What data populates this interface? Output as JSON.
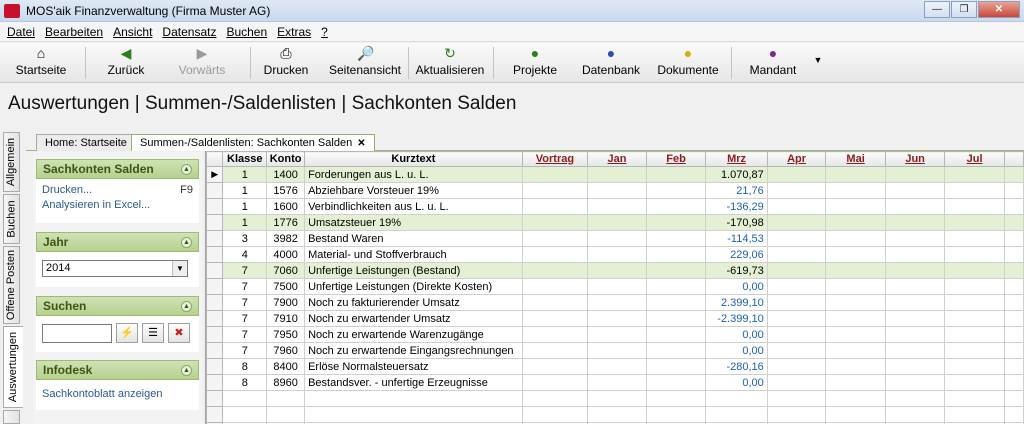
{
  "window": {
    "title": "MOS'aik Finanzverwaltung (Firma Muster AG)"
  },
  "menu": [
    "Datei",
    "Bearbeiten",
    "Ansicht",
    "Datensatz",
    "Buchen",
    "Extras",
    "?"
  ],
  "toolbar": {
    "startseite": "Startseite",
    "zurueck": "Zurück",
    "vorwaerts": "Vorwärts",
    "drucken": "Drucken",
    "seitenansicht": "Seitenansicht",
    "aktualisieren": "Aktualisieren",
    "projekte": "Projekte",
    "datenbank": "Datenbank",
    "dokumente": "Dokumente",
    "mandant": "Mandant"
  },
  "heading": "Auswertungen | Summen-/Saldenlisten | Sachkonten Salden",
  "vertical_tabs": [
    "Allgemein",
    "Buchen",
    "Offene Posten",
    "Auswertungen"
  ],
  "doc_tabs": {
    "home": "Home: Startseite",
    "active": "Summen-/Saldenlisten: Sachkonten Salden"
  },
  "sidebar": {
    "sachkonten": {
      "title": "Sachkonten Salden",
      "drucken": "Drucken...",
      "shortcut": "F9",
      "excel": "Analysieren in Excel..."
    },
    "jahr": {
      "title": "Jahr",
      "value": "2014"
    },
    "suchen": {
      "title": "Suchen"
    },
    "infodesk": {
      "title": "Infodesk",
      "link": "Sachkontoblatt anzeigen"
    }
  },
  "grid": {
    "columns": {
      "klasse": "Klasse",
      "konto": "Konto",
      "kurztext": "Kurztext",
      "vortrag": "Vortrag",
      "jan": "Jan",
      "feb": "Feb",
      "mrz": "Mrz",
      "apr": "Apr",
      "mai": "Mai",
      "jun": "Jun",
      "jul": "Jul"
    },
    "rows": [
      {
        "klasse": "1",
        "konto": "1400",
        "kurztext": "Forderungen aus L. u. L.",
        "mrz": "1.070,87"
      },
      {
        "klasse": "1",
        "konto": "1576",
        "kurztext": "Abziehbare Vorsteuer 19%",
        "mrz": "21,76"
      },
      {
        "klasse": "1",
        "konto": "1600",
        "kurztext": "Verbindlichkeiten aus L. u. L.",
        "mrz": "-136,29"
      },
      {
        "klasse": "1",
        "konto": "1776",
        "kurztext": "Umsatzsteuer 19%",
        "mrz": "-170,98"
      },
      {
        "klasse": "3",
        "konto": "3982",
        "kurztext": "Bestand Waren",
        "mrz": "-114,53"
      },
      {
        "klasse": "4",
        "konto": "4000",
        "kurztext": "Material- und Stoffverbrauch",
        "mrz": "229,06"
      },
      {
        "klasse": "7",
        "konto": "7060",
        "kurztext": "Unfertige Leistungen (Bestand)",
        "mrz": "-619,73"
      },
      {
        "klasse": "7",
        "konto": "7500",
        "kurztext": "Unfertige Leistungen (Direkte Kosten)",
        "mrz": "0,00"
      },
      {
        "klasse": "7",
        "konto": "7900",
        "kurztext": "Noch zu fakturierender Umsatz",
        "mrz": "2.399,10"
      },
      {
        "klasse": "7",
        "konto": "7910",
        "kurztext": "Noch zu erwartender Umsatz",
        "mrz": "-2.399,10"
      },
      {
        "klasse": "7",
        "konto": "7950",
        "kurztext": "Noch zu erwartende Warenzugänge",
        "mrz": "0,00"
      },
      {
        "klasse": "7",
        "konto": "7960",
        "kurztext": "Noch zu erwartende Eingangsrechnungen",
        "mrz": "0,00"
      },
      {
        "klasse": "8",
        "konto": "8400",
        "kurztext": "Erlöse Normalsteuersatz",
        "mrz": "-280,16"
      },
      {
        "klasse": "8",
        "konto": "8960",
        "kurztext": "Bestandsver. - unfertige Erzeugnisse",
        "mrz": "0,00"
      }
    ]
  }
}
